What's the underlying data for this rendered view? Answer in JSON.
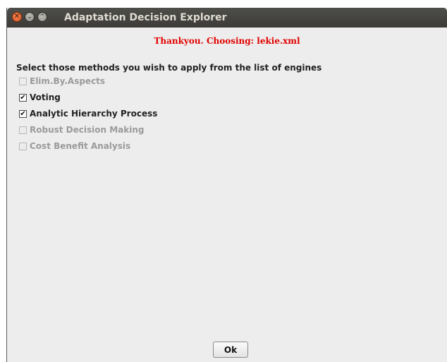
{
  "window": {
    "title": "Adaptation Decision Explorer",
    "close_glyph": "✕",
    "minimize_glyph": "⌄",
    "maximize_glyph": "⌃"
  },
  "status_message": "Thankyou. Choosing: lekie.xml",
  "instruction": "Select those methods you wish to apply from the list of engines",
  "methods": [
    {
      "label": "Elim.By.Aspects",
      "checked": false,
      "enabled": false
    },
    {
      "label": "Voting",
      "checked": true,
      "enabled": true
    },
    {
      "label": "Analytic Hierarchy Process",
      "checked": true,
      "enabled": true
    },
    {
      "label": "Robust Decision Making",
      "checked": false,
      "enabled": false
    },
    {
      "label": "Cost Benefit Analysis",
      "checked": false,
      "enabled": false
    }
  ],
  "check_glyph": "✔",
  "ok_label": "Ok",
  "colors": {
    "status_text": "#e30000",
    "titlebar": "#3c3b37",
    "close_button": "#e0541f",
    "background": "#ededed"
  }
}
